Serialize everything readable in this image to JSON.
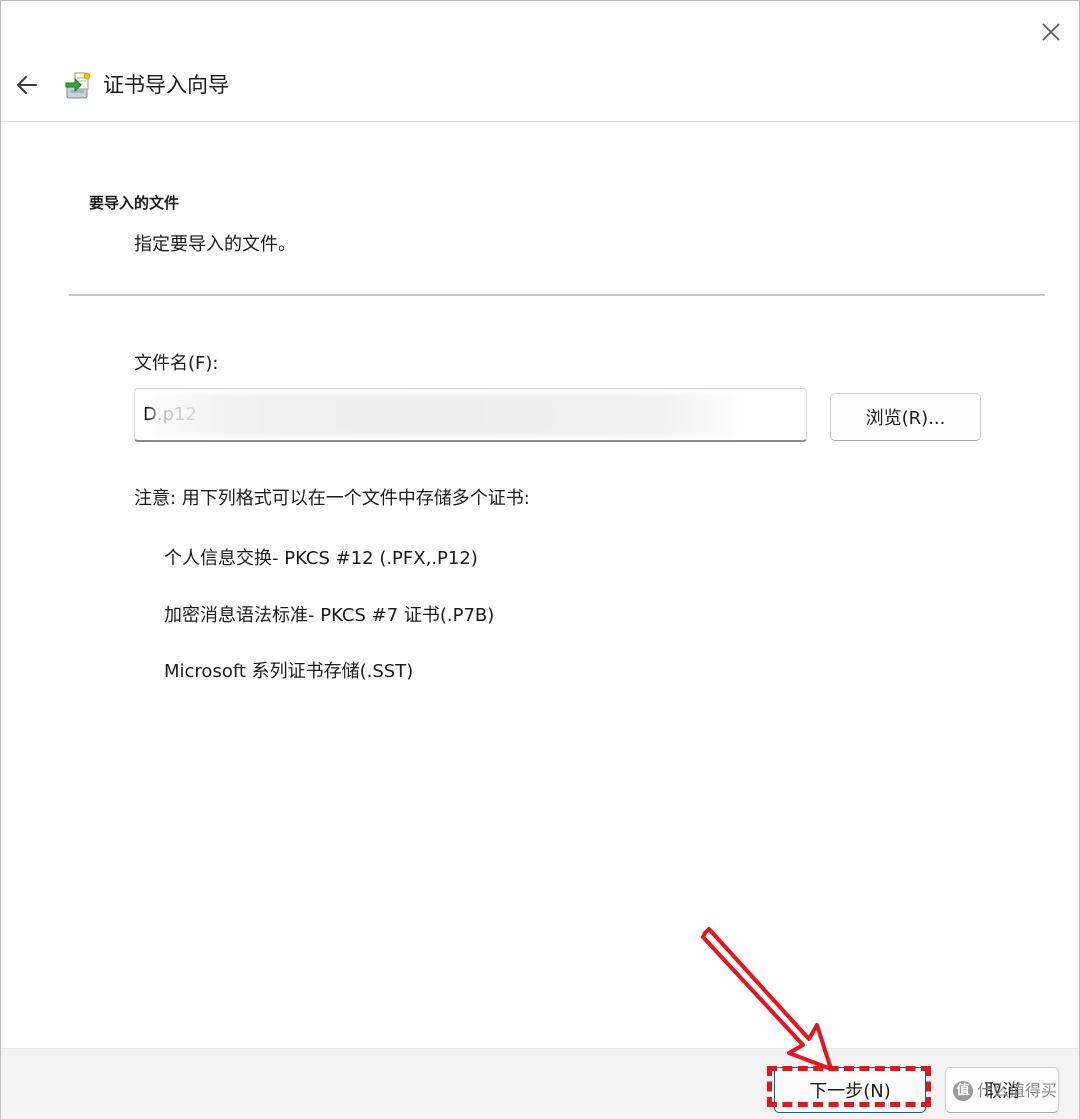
{
  "window": {
    "close_icon": "close-icon",
    "back_icon": "back-arrow-icon",
    "title_icon": "certificate-wizard-icon",
    "title": "证书导入向导"
  },
  "page": {
    "section_title": "要导入的文件",
    "section_subtitle": "指定要导入的文件。",
    "file_label": "文件名(F):",
    "file_value": "D.p12",
    "browse_label": "浏览(R)...",
    "note": "注意: 用下列格式可以在一个文件中存储多个证书:",
    "formats": [
      "个人信息交换- PKCS #12 (.PFX,.P12)",
      "加密消息语法标准- PKCS #7 证书(.P7B)",
      "Microsoft 系列证书存储(.SST)"
    ]
  },
  "footer": {
    "next_label": "下一步(N)",
    "cancel_label": "取消"
  },
  "annotation": {
    "highlight_color": "#e8141c",
    "watermark_logo": "值",
    "watermark_text": "什么值得买"
  }
}
